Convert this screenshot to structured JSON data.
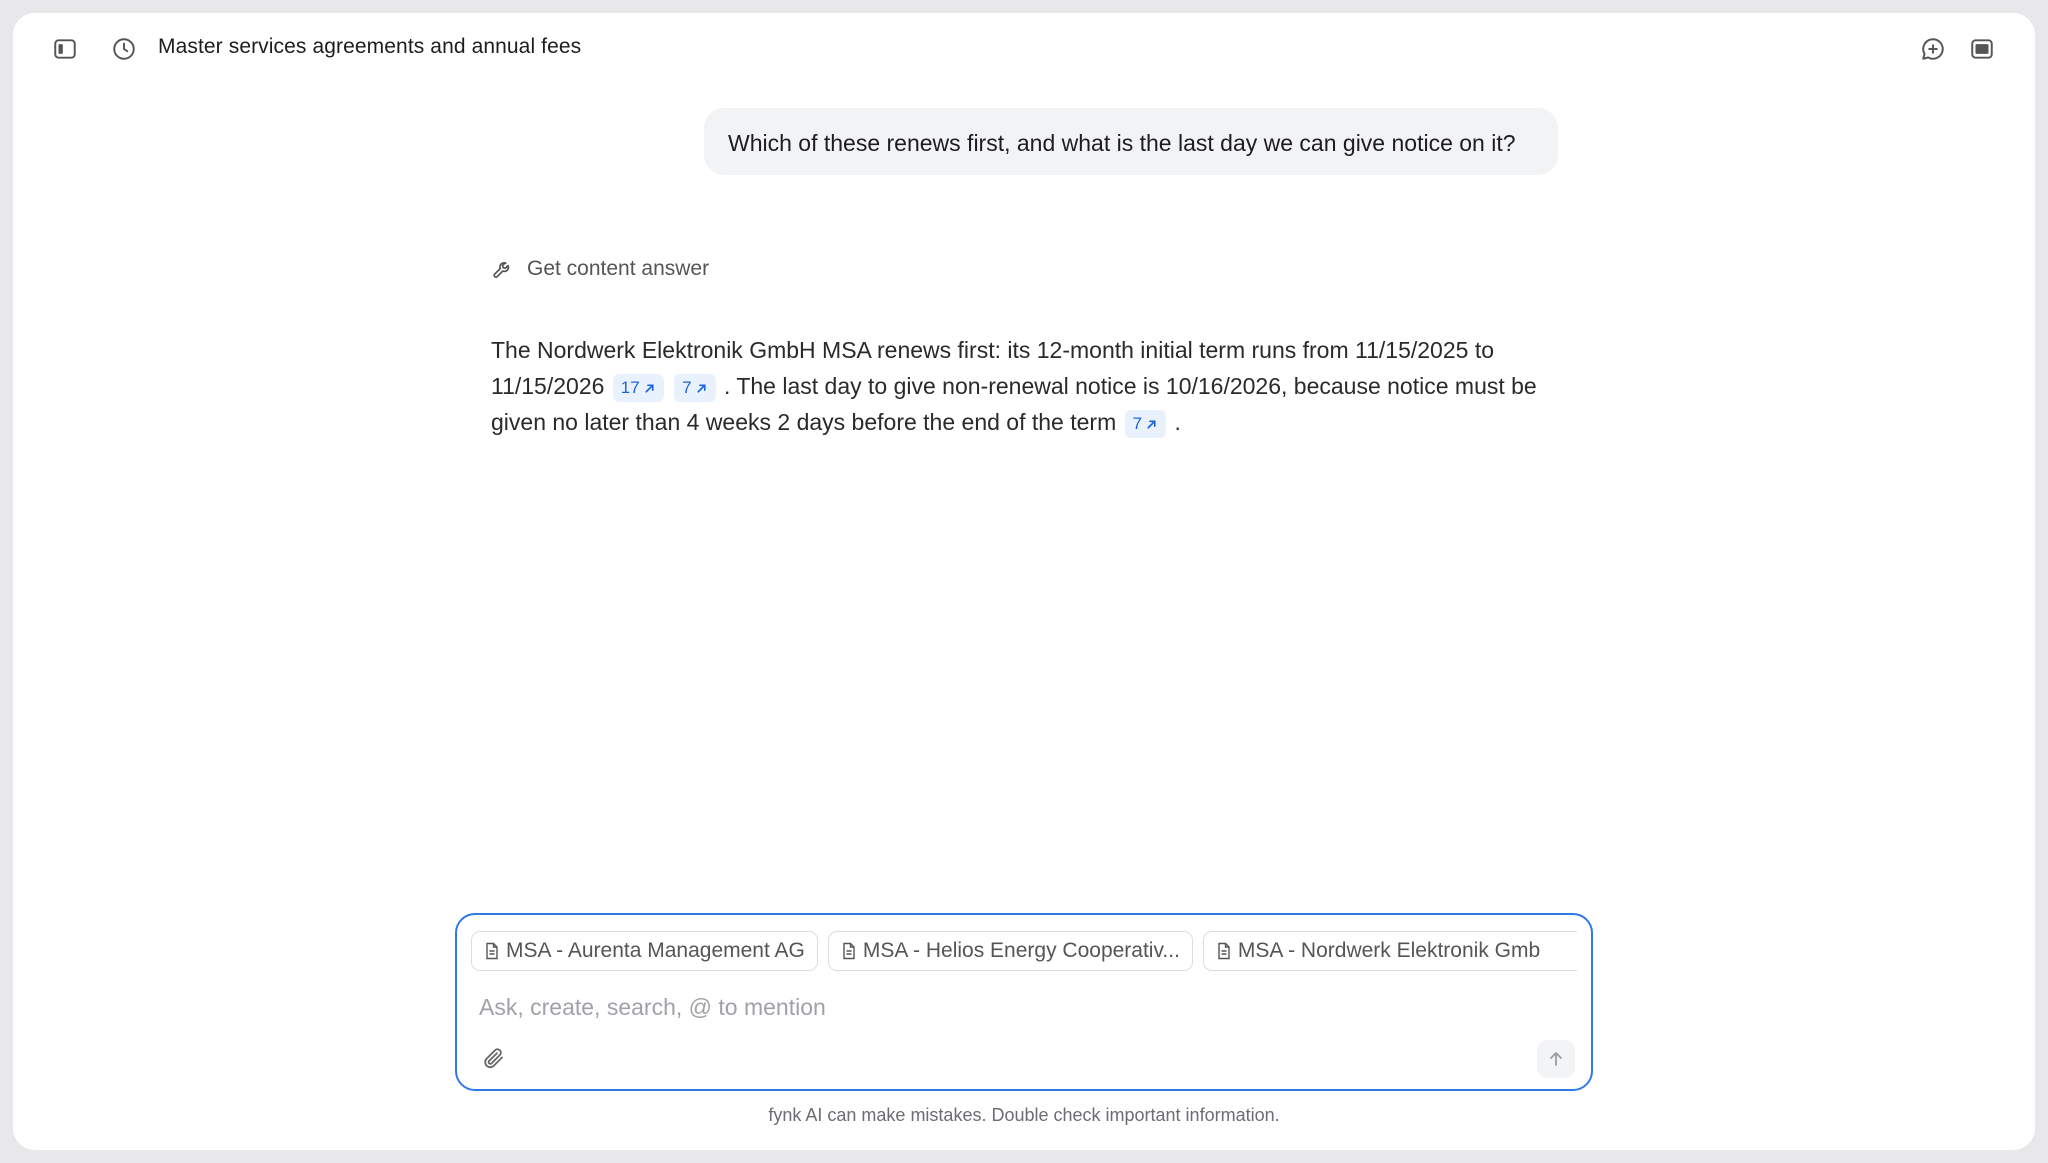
{
  "header": {
    "title": "Master services agreements and annual fees",
    "icons": {
      "sidebar_toggle": "sidebar-toggle-icon",
      "history": "history-icon",
      "new_chat": "new-chat-icon",
      "panel": "panel-icon"
    }
  },
  "conversation": {
    "user_message": "Which of these renews first, and what is the last day we can give notice on it?",
    "tool_call": {
      "icon": "wrench-icon",
      "label": "Get content answer"
    },
    "answer": {
      "part1": "The Nordwerk Elektronik GmbH MSA renews first: its 12-month initial term runs from 11/15/2025 to 11/15/2026",
      "part2": ". The last day to give non-renewal notice is 10/16/2026, because notice must be given no later than 4 weeks 2 days before the end of the term",
      "part3": ".",
      "citations": [
        "17",
        "7",
        "7"
      ]
    }
  },
  "composer": {
    "attached_documents": [
      "MSA - Aurenta Management AG",
      "MSA - Helios Energy Cooperativ...",
      "MSA - Nordwerk Elektronik Gmb"
    ],
    "placeholder": "Ask, create, search, @ to mention",
    "value": ""
  },
  "footer": {
    "disclaimer": "fynk AI can make mistakes. Double check important information."
  },
  "colors": {
    "accent": "#2f7ae6",
    "citation_bg": "#e9f1fd",
    "citation_text": "#1a66d6",
    "bubble_bg": "#f2f3f5"
  }
}
